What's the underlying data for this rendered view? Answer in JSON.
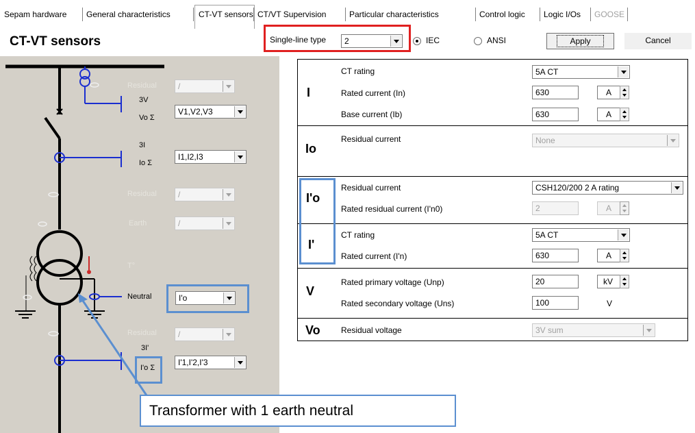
{
  "tabs": [
    {
      "label": "Sepam hardware",
      "active": false,
      "enabled": true
    },
    {
      "label": "General characteristics",
      "active": false,
      "enabled": true
    },
    {
      "label": "CT-VT sensors",
      "active": true,
      "enabled": true
    },
    {
      "label": "CT/VT Supervision",
      "active": false,
      "enabled": true
    },
    {
      "label": "Particular characteristics",
      "active": false,
      "enabled": true
    },
    {
      "label": "Control logic",
      "active": false,
      "enabled": true
    },
    {
      "label": "Logic I/Os",
      "active": false,
      "enabled": true
    },
    {
      "label": "GOOSE",
      "active": false,
      "enabled": false
    }
  ],
  "page_title": "CT-VT sensors",
  "toolbar": {
    "single_line_label": "Single-line type",
    "single_line_value": "2",
    "iec_label": "IEC",
    "ansi_label": "ANSI",
    "selected_standard": "IEC",
    "apply_label": "Apply",
    "cancel_label": "Cancel"
  },
  "diagram": {
    "rows": [
      {
        "label": "Residual",
        "combo": "/",
        "enabled": false
      },
      {
        "sym_top": "3V",
        "sym_bottom": "Vo Σ",
        "combo": "V1,V2,V3",
        "enabled": true
      },
      {
        "sym_top": "3I",
        "sym_bottom": "Io Σ",
        "combo": "I1,I2,I3",
        "enabled": true
      },
      {
        "label": "Residual",
        "combo": "/",
        "enabled": false
      },
      {
        "label": "Earth",
        "combo": "/",
        "enabled": false
      },
      {
        "label": "T°",
        "combo": "",
        "enabled": false
      },
      {
        "label": "Neutral",
        "combo": "I'o",
        "enabled": true
      },
      {
        "label": "Residual",
        "combo": "/",
        "enabled": false
      },
      {
        "sym_top": "3I'",
        "sym_bottom": "I'o Σ",
        "combo": "I'1,I'2,I'3",
        "enabled": true
      }
    ],
    "callout": "Transformer with 1 earth neutral"
  },
  "sections": {
    "I": {
      "symbol": "I",
      "ct_rating_label": "CT rating",
      "ct_rating_value": "5A CT",
      "rated_current_label": "Rated current (In)",
      "rated_current_value": "630",
      "rated_current_unit": "A",
      "base_current_label": "Base current (Ib)",
      "base_current_value": "630",
      "base_current_unit": "A"
    },
    "Io": {
      "symbol": "Io",
      "residual_label": "Residual current",
      "residual_value": "None"
    },
    "I_o_prime": {
      "symbol": "I'o",
      "residual_label": "Residual current",
      "residual_value": "CSH120/200 2 A rating",
      "rated_residual_label": "Rated residual current (I'n0)",
      "rated_residual_value": "2",
      "rated_residual_unit": "A"
    },
    "I_prime": {
      "symbol": "I'",
      "ct_rating_label": "CT rating",
      "ct_rating_value": "5A CT",
      "rated_current_label": "Rated current (I'n)",
      "rated_current_value": "630",
      "rated_current_unit": "A"
    },
    "V": {
      "symbol": "V",
      "primary_label": "Rated primary voltage (Unp)",
      "primary_value": "20",
      "primary_unit": "kV",
      "secondary_label": "Rated secondary voltage (Uns)",
      "secondary_value": "100",
      "secondary_unit": "V"
    },
    "Vo": {
      "symbol": "Vo",
      "residual_label": "Residual voltage",
      "residual_value": "3V sum"
    }
  },
  "colors": {
    "highlight_red": "#e02020",
    "highlight_blue": "#5b8fd0",
    "circuit_blue": "#1a2ed0",
    "panel_gray": "#d4d0c8"
  }
}
